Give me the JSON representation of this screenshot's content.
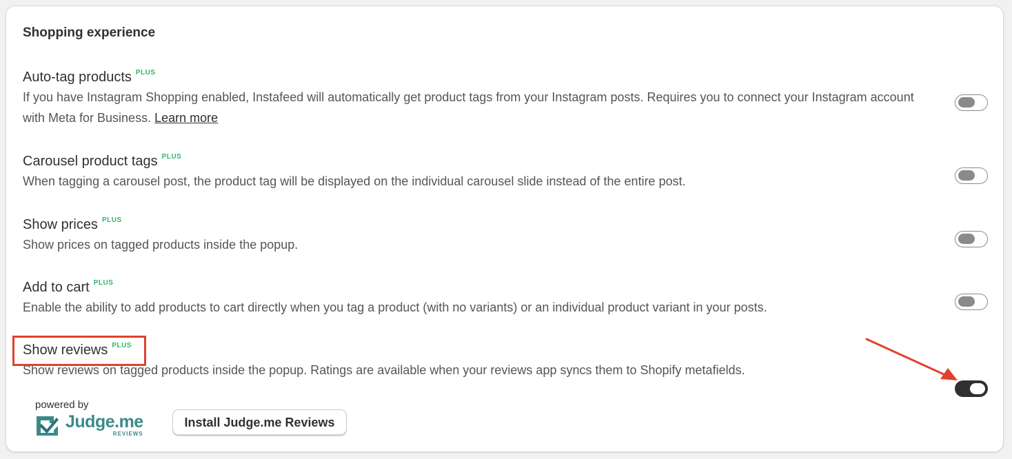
{
  "section": {
    "title": "Shopping experience"
  },
  "plus_badge": "PLUS",
  "settings": [
    {
      "title": "Auto-tag products",
      "description": "If you have Instagram Shopping enabled, Instafeed will automatically get product tags from your Instagram posts. Requires you to connect your Instagram account with Meta for Business.",
      "link": "Learn more",
      "enabled": false
    },
    {
      "title": "Carousel product tags",
      "description": "When tagging a carousel post, the product tag will be displayed on the individual carousel slide instead of the entire post.",
      "enabled": false
    },
    {
      "title": "Show prices",
      "description": "Show prices on tagged products inside the popup.",
      "enabled": false
    },
    {
      "title": "Add to cart",
      "description": "Enable the ability to add products to cart directly when you tag a product (with no variants) or an individual product variant in your posts.",
      "enabled": false
    },
    {
      "title": "Show reviews",
      "description": "Show reviews on tagged products inside the popup. Ratings are available when your reviews app syncs them to Shopify metafields.",
      "enabled": true
    }
  ],
  "powered_by": {
    "label": "powered by",
    "brand": "Judge.me",
    "brand_sub": "REVIEWS"
  },
  "install_button": "Install Judge.me Reviews",
  "colors": {
    "plus_badge": "#2fb866",
    "highlight": "#e0412d",
    "toggle_on": "#303030",
    "brand": "#3b8a8a"
  },
  "icons": {
    "brand_logo": "judgeme-checkmark-logo",
    "annotation": "red-arrow"
  }
}
